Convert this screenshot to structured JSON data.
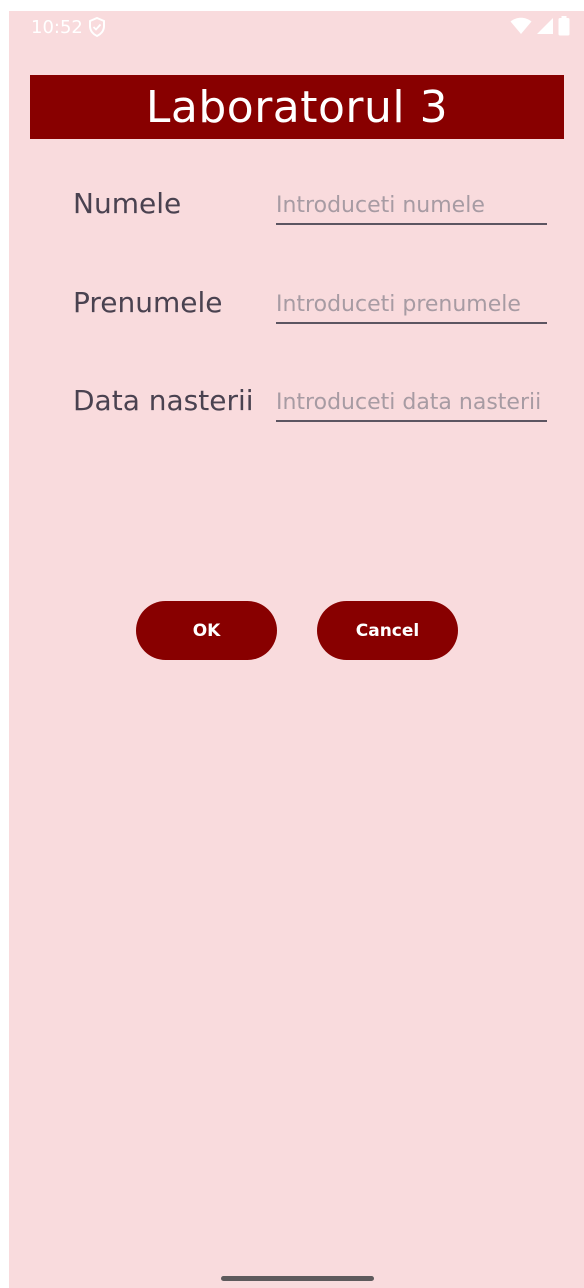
{
  "status_bar": {
    "time": "10:52",
    "left_icons": [
      "shield-icon"
    ],
    "right_icons": [
      "wifi-icon",
      "signal-icon",
      "battery-icon"
    ]
  },
  "header": {
    "title": "Laboratorul 3"
  },
  "form": {
    "fields": [
      {
        "label": "Numele",
        "value": "",
        "placeholder": "Introduceti numele"
      },
      {
        "label": "Prenumele",
        "value": "",
        "placeholder": "Introduceti prenumele"
      },
      {
        "label": "Data nasterii",
        "value": "",
        "placeholder": "Introduceti data nasterii"
      }
    ]
  },
  "buttons": {
    "ok_label": "OK",
    "cancel_label": "Cancel"
  },
  "colors": {
    "background": "#f9dbdd",
    "accent": "#880000",
    "label_text": "#4a4250",
    "placeholder_text": "#a79ba3"
  }
}
